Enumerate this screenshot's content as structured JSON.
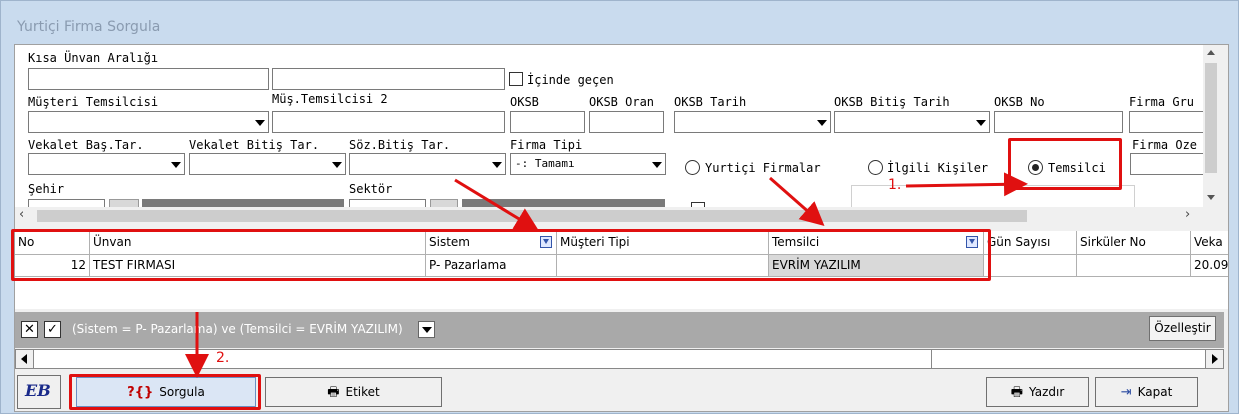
{
  "window": {
    "title": "Yurtiçi Firma Sorgula"
  },
  "form": {
    "kisa_unvan_label": "Kısa Ünvan Aralığı",
    "icinde_gecen_label": "İçinde geçen",
    "musteri_temsilcisi_label": "Müşteri Temsilcisi",
    "mus_temsilcisi2_label": "Müş.Temsilcisi 2",
    "oksb_label": "OKSB",
    "oksb_oran_label": "OKSB Oran",
    "oksb_tarih_label": "OKSB Tarih",
    "oksb_bitis_label": "OKSB Bitiş Tarih",
    "oksb_no_label": "OKSB No",
    "firma_grubu_label": "Firma Gru",
    "vekalet_bas_label": "Vekalet  Baş.Tar.",
    "vekalet_bitis_label": "Vekalet Bitiş Tar.",
    "soz_bitis_label": "Söz.Bitiş Tar.",
    "firma_tipi_label": "Firma Tipi",
    "firma_tipi_value": "-: Tamamı",
    "firma_oze_label": "Firma Oze",
    "sehir_label": "Şehir",
    "sektor_label": "Sektör",
    "radio_yurtici": "Yurtiçi Firmalar",
    "radio_ilgili": "İlgili Kişiler",
    "radio_temsilci": "Temsilci"
  },
  "grid": {
    "columns": [
      "No",
      "Ünvan",
      "Sistem",
      "Müşteri Tipi",
      "Temsilci",
      "Gün Sayısı",
      "Sirküler No",
      "Veka"
    ],
    "rows": [
      {
        "no": "12",
        "unvan": "TEST FIRMASI",
        "sistem": "P- Pazarlama",
        "musteri_tipi": "",
        "temsilci": "EVRİM YAZILIM",
        "gun": "",
        "sirkuler": "",
        "veka": "20.09"
      }
    ]
  },
  "filterbar": {
    "expression": "(Sistem = P- Pazarlama) ve (Temsilci = EVRİM YAZILIM)",
    "customize": "Özelleştir",
    "close_glyph": "✕",
    "check_glyph": "✓"
  },
  "buttons": {
    "logo": "EB",
    "sorgula": "Sorgula",
    "etiket": "Etiket",
    "yazdir": "Yazdır",
    "kapat": "Kapat"
  },
  "annotations": {
    "step1": "1.",
    "step2": "2."
  },
  "colors": {
    "annotation": "#e01010",
    "filterbar": "#a9a9a9",
    "window": "#c9dbee"
  }
}
